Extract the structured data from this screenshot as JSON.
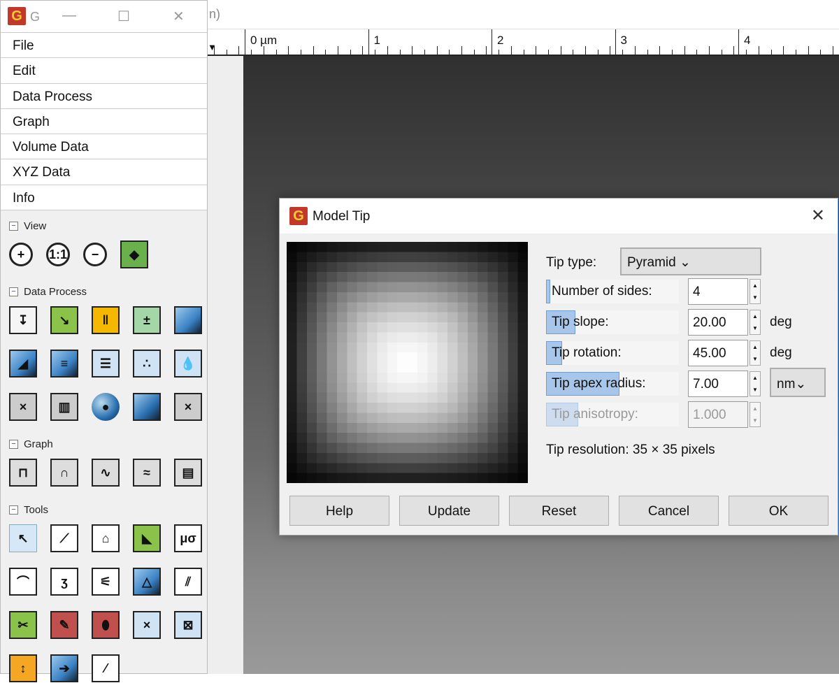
{
  "main": {
    "title_fragment": "n)",
    "ruler_labels": [
      "0 µm",
      "1",
      "2",
      "3",
      "4"
    ]
  },
  "toolbox": {
    "title": "G",
    "menu": [
      "File",
      "Edit",
      "Data Process",
      "Graph",
      "Volume Data",
      "XYZ Data",
      "Info"
    ],
    "sections": [
      {
        "label": "View",
        "rows": [
          [
            [
              "zoom-in-icon",
              "+",
              "#fff"
            ],
            [
              "zoom-1-1-icon",
              "1:1",
              "#fff"
            ],
            [
              "zoom-out-icon",
              "−",
              "#fff"
            ],
            [
              "3d-view-icon",
              "◆",
              "#6ab04c"
            ]
          ]
        ]
      },
      {
        "label": "Data Process",
        "rows": [
          [
            [
              "fix-zero-icon",
              "↧",
              "#f5f5f5"
            ],
            [
              "crop-icon",
              "↘",
              "#8bc34a"
            ],
            [
              "scale-icon",
              "‖",
              "#f5b800"
            ],
            [
              "arithmetic-icon",
              "±",
              "#a5d6a7"
            ],
            [
              "gradient-icon",
              "",
              "#3b82c4"
            ]
          ],
          [
            [
              "facet-level-icon",
              "◢",
              "#3b82c4"
            ],
            [
              "line-correction-icon",
              "≡",
              "#3b82c4"
            ],
            [
              "align-rows-icon",
              "☰",
              "#cfe3f5"
            ],
            [
              "grains-icon",
              "∴",
              "#cfe3f5"
            ],
            [
              "watershed-icon",
              "💧",
              "#cfe3f5"
            ]
          ],
          [
            [
              "remove-grains-icon",
              "×",
              "#ccc"
            ],
            [
              "grain-distribution-icon",
              "▥",
              "#ccc"
            ],
            [
              "sphere-icon",
              "●",
              "#fff"
            ],
            [
              "shade-icon",
              "",
              "#2a6fb0"
            ],
            [
              "remove-spots-icon",
              "×",
              "#ccc"
            ]
          ]
        ]
      },
      {
        "label": "Graph",
        "rows": [
          [
            [
              "graph-cut-icon",
              "⊓",
              "#ddd"
            ],
            [
              "graph-fit-icon",
              "∩",
              "#ddd"
            ],
            [
              "graph-critical-icon",
              "∿",
              "#ddd"
            ],
            [
              "graph-level-icon",
              "≈",
              "#ddd"
            ],
            [
              "graph-export-icon",
              "▤",
              "#ddd"
            ]
          ]
        ]
      },
      {
        "label": "Tools",
        "rows": [
          [
            [
              "pointer-tool-icon",
              "↖",
              "#d6e8f8"
            ],
            [
              "distance-tool-icon",
              "⟋",
              "#fff"
            ],
            [
              "profile-tool-icon",
              "⌂",
              "#fff"
            ],
            [
              "slope-tool-icon",
              "◣",
              "#8bc34a"
            ],
            [
              "statistics-tool-icon",
              "μσ",
              "#fff"
            ]
          ],
          [
            [
              "roughness-tool-icon",
              "⌒",
              "#fff"
            ],
            [
              "curve-tool-icon",
              "ʒ",
              "#fff"
            ],
            [
              "spectro-tool-icon",
              "⚟",
              "#fff"
            ],
            [
              "mask-editor-icon",
              "△",
              "#3b82c4"
            ],
            [
              "line-stats-icon",
              "⫽",
              "#fff"
            ]
          ],
          [
            [
              "crop-tool-icon",
              "✂",
              "#8bc34a"
            ],
            [
              "mask-paint-icon",
              "✎",
              "#c0504d"
            ],
            [
              "grain-measure-icon",
              "⬮",
              "#c0504d"
            ],
            [
              "spot-remove-icon",
              "×",
              "#cfe3f5"
            ],
            [
              "selection-manager-icon",
              "⊠",
              "#cfe3f5"
            ]
          ],
          [
            [
              "color-range-icon",
              "↕",
              "#f5a623"
            ],
            [
              "read-value-icon",
              "➔",
              "#3b82c4"
            ],
            [
              "correct-affine-icon",
              "⁄",
              "#fff"
            ]
          ]
        ]
      }
    ]
  },
  "dialog": {
    "title": "Model Tip",
    "tip_type_label": "Tip type:",
    "tip_type_value": "Pyramid",
    "params": [
      {
        "label": "Number of sides:",
        "value": "4",
        "unit": "",
        "adjust_fraction": 0.03,
        "enabled": true
      },
      {
        "label": "Tip slope:",
        "value": "20.00",
        "unit": "deg",
        "adjust_fraction": 0.22,
        "enabled": true
      },
      {
        "label": "Tip rotation:",
        "value": "45.00",
        "unit": "deg",
        "adjust_fraction": 0.12,
        "enabled": true
      },
      {
        "label": "Tip apex radius:",
        "value": "7.00",
        "unit": "nm",
        "adjust_fraction": 0.55,
        "enabled": true
      },
      {
        "label": "Tip anisotropy:",
        "value": "1.000",
        "unit": "",
        "adjust_fraction": 0.24,
        "enabled": false
      }
    ],
    "resolution": "Tip resolution: 35 × 35 pixels",
    "buttons": [
      "Help",
      "Update",
      "Reset",
      "Cancel",
      "OK"
    ]
  }
}
